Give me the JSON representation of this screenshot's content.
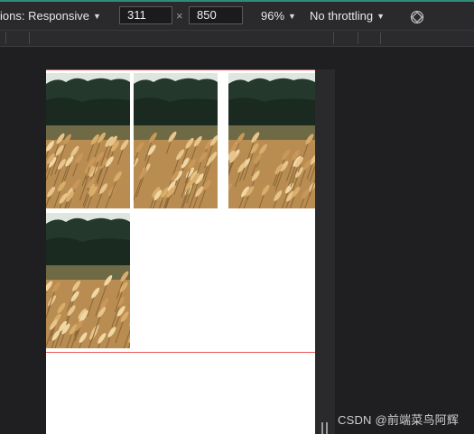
{
  "toolbar": {
    "dimensions_label": "ions: Responsive",
    "width_value": "311",
    "times_glyph": "×",
    "height_value": "850",
    "zoom_label": "96%",
    "throttle_label": "No throttling",
    "rotate_icon": "rotate-icon",
    "dropdown_icon": "caret-down-icon"
  },
  "preview": {
    "image_count": 4,
    "image_subject": "wheat-field-photo"
  },
  "watermark": {
    "text": "CSDN @前端菜鸟阿辉"
  },
  "colors": {
    "toolbar_bg": "#2a2a2d",
    "outline_red": "#ee5a5a",
    "accent_teal": "#2f8c7a"
  }
}
